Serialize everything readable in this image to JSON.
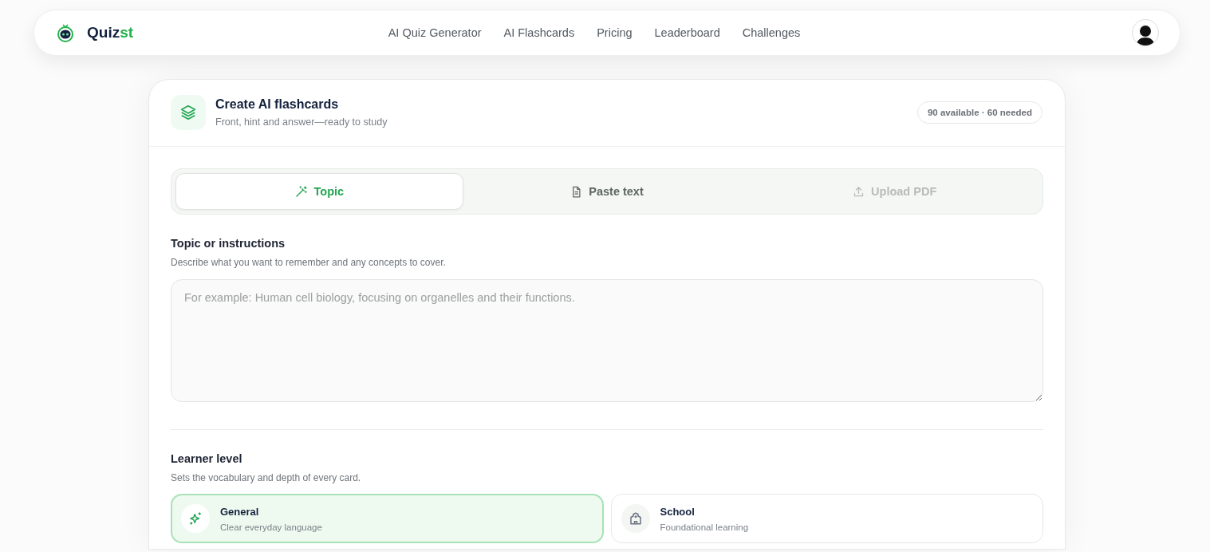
{
  "nav": {
    "logo": {
      "text": "Quiz",
      "accent": "st"
    },
    "links": [
      {
        "label": "AI Quiz Generator"
      },
      {
        "label": "AI Flashcards"
      },
      {
        "label": "Pricing"
      },
      {
        "label": "Leaderboard"
      },
      {
        "label": "Challenges"
      }
    ]
  },
  "card": {
    "title": "Create AI flashcards",
    "subtitle": "Front, hint and answer—ready to study",
    "badge": "90 available · 60 needed",
    "tabs": [
      {
        "kind": "topic",
        "label": "Topic",
        "selected": true,
        "disabled": false
      },
      {
        "kind": "paste",
        "label": "Paste text",
        "selected": false,
        "disabled": false
      },
      {
        "kind": "upload",
        "label": "Upload PDF",
        "selected": false,
        "disabled": true
      }
    ],
    "topic": {
      "label": "Topic or instructions",
      "description": "Describe what you want to remember and any concepts to cover.",
      "placeholder": "For example: Human cell biology, focusing on organelles and their functions."
    },
    "level": {
      "label": "Learner level",
      "description": "Sets the vocabulary and depth of every card.",
      "options": [
        {
          "kind": "general",
          "title": "General",
          "description": "Clear everyday language",
          "selected": true
        },
        {
          "kind": "school",
          "title": "School",
          "description": "Foundational learning",
          "selected": false
        }
      ]
    }
  }
}
